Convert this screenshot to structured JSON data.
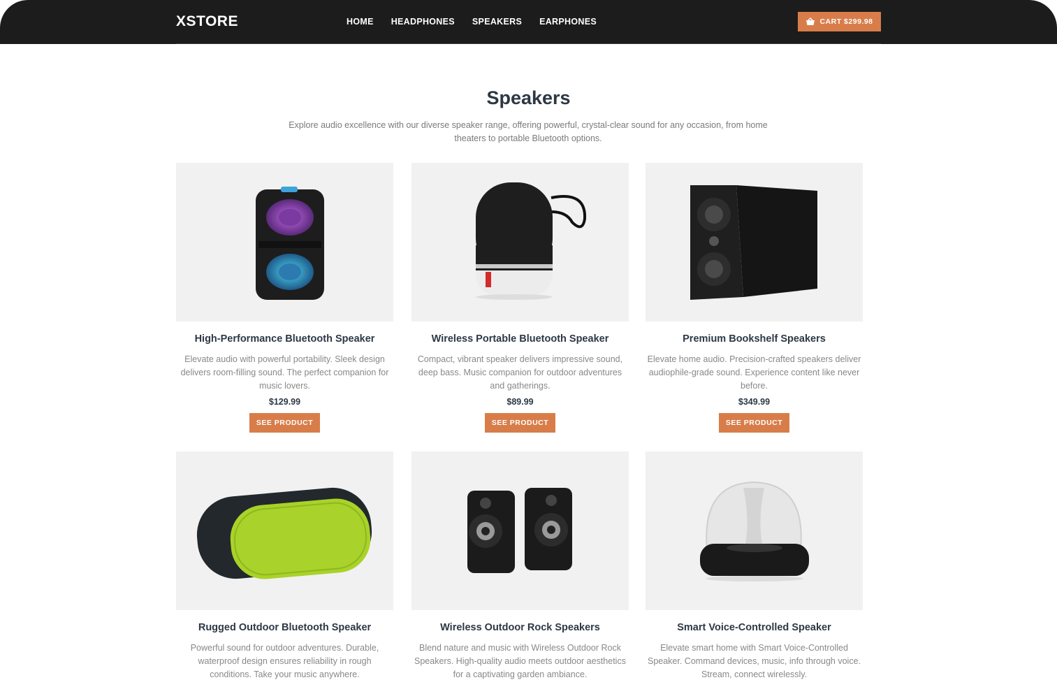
{
  "header": {
    "logo": "XSTORE",
    "nav": [
      "HOME",
      "HEADPHONES",
      "SPEAKERS",
      "EARPHONES"
    ],
    "cart_label": "CART $299.98"
  },
  "page": {
    "title": "Speakers",
    "subtitle": "Explore audio excellence with our diverse speaker range, offering powerful, crystal-clear sound for any occasion, from home theaters to portable Bluetooth options."
  },
  "products": [
    {
      "name": "High-Performance Bluetooth Speaker",
      "description": "Elevate audio with powerful portability. Sleek design delivers room-filling sound. The perfect companion for music lovers.",
      "price": "$129.99",
      "button": "SEE PRODUCT",
      "image": "party-speaker"
    },
    {
      "name": "Wireless Portable Bluetooth Speaker",
      "description": "Compact, vibrant speaker delivers impressive sound, deep bass. Music companion for outdoor adventures and gatherings.",
      "price": "$89.99",
      "button": "SEE PRODUCT",
      "image": "cylinder-speaker"
    },
    {
      "name": "Premium Bookshelf Speakers",
      "description": "Elevate home audio. Precision-crafted speakers deliver audiophile-grade sound. Experience content like never before.",
      "price": "$349.99",
      "button": "SEE PRODUCT",
      "image": "bookshelf-speaker"
    },
    {
      "name": "Rugged Outdoor Bluetooth Speaker",
      "description": "Powerful sound for outdoor adventures. Durable, waterproof design ensures reliability in rough conditions. Take your music anywhere.",
      "price": "",
      "button": "",
      "image": "rugged-speaker"
    },
    {
      "name": "Wireless Outdoor Rock Speakers",
      "description": "Blend nature and music with Wireless Outdoor Rock Speakers. High-quality audio meets outdoor aesthetics for a captivating garden ambiance.",
      "price": "",
      "button": "",
      "image": "pair-speakers"
    },
    {
      "name": "Smart Voice-Controlled Speaker",
      "description": "Elevate smart home with Smart Voice-Controlled Speaker. Command devices, music, info through voice. Stream, connect wirelessly.",
      "price": "",
      "button": "",
      "image": "dome-speaker"
    }
  ],
  "colors": {
    "accent": "#d87d4a",
    "header_bg": "#1c1c1c",
    "card_bg": "#f1f1f1"
  }
}
